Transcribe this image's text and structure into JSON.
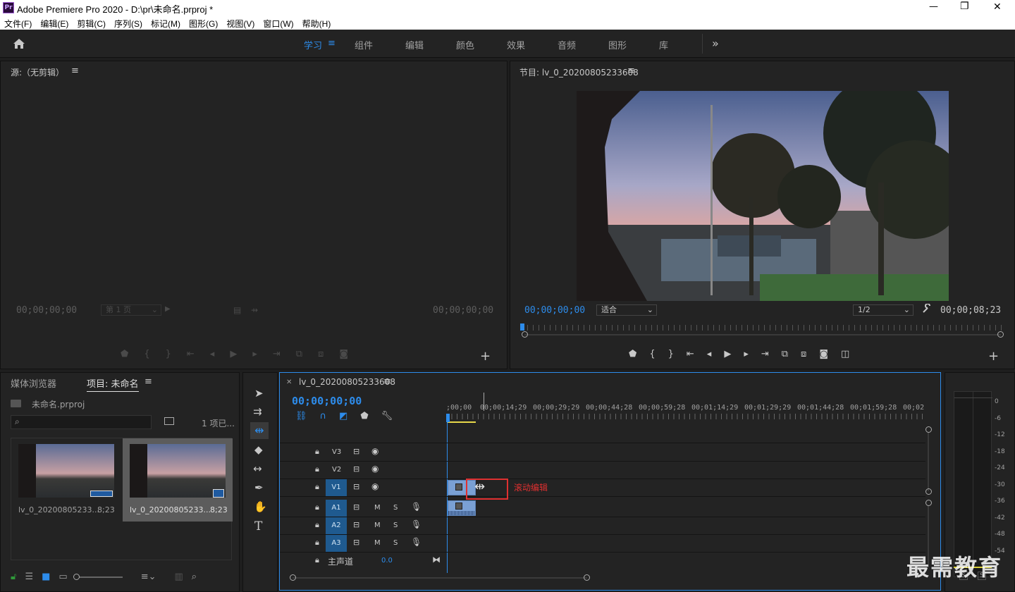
{
  "app": {
    "logo": "Pr",
    "title": "Adobe Premiere Pro 2020 - D:\\pr\\未命名.prproj *",
    "window_controls": {
      "minimize": "—",
      "maximize": "❐",
      "close": "✕"
    }
  },
  "menu": [
    "文件(F)",
    "编辑(E)",
    "剪辑(C)",
    "序列(S)",
    "标记(M)",
    "图形(G)",
    "视图(V)",
    "窗口(W)",
    "帮助(H)"
  ],
  "workspaces": {
    "tabs": [
      "学习",
      "组件",
      "编辑",
      "颜色",
      "效果",
      "音频",
      "图形",
      "库"
    ],
    "active": "学习",
    "more": "»"
  },
  "source_monitor": {
    "title": "源:（无剪辑）",
    "timecode_left": "00;00;00;00",
    "page_select": "第 1 页",
    "timecode_right": "00;00;00;00"
  },
  "program_monitor": {
    "title": "节目: lv_0_20200805233608",
    "timecode": "00;00;00;00",
    "fit_select": "适合",
    "resolution_select": "1/2",
    "duration": "00;00;08;23"
  },
  "project_panel": {
    "tabs": [
      "媒体浏览器",
      "项目: 未命名"
    ],
    "project_file": "未命名.prproj",
    "item_count": "1 项已...",
    "search_placeholder": "",
    "clips": [
      {
        "name": "lv_0_20200805233...",
        "duration": "8;23"
      },
      {
        "name": "lv_0_20200805233...",
        "duration": "8;23"
      }
    ]
  },
  "timeline": {
    "sequence_tab": "lv_0_20200805233608",
    "timecode": "00;00;00;00",
    "ruler": [
      ";00;00",
      "00;00;14;29",
      "00;00;29;29",
      "00;00;44;28",
      "00;00;59;28",
      "00;01;14;29",
      "00;01;29;29",
      "00;01;44;28",
      "00;01;59;28",
      "00;02;"
    ],
    "video_tracks": [
      "V3",
      "V2",
      "V1"
    ],
    "audio_tracks": [
      "A1",
      "A2",
      "A3"
    ],
    "master_label": "主声道",
    "master_value": "0.0",
    "annotation": "滚动编辑",
    "mute": "M",
    "solo": "S"
  },
  "audio_meter": {
    "scale": [
      "0",
      "-6",
      "-12",
      "-18",
      "-24",
      "-30",
      "-36",
      "-42",
      "-48",
      "-54"
    ],
    "solo_labels": [
      "S",
      "S"
    ]
  },
  "watermark": "最需教育",
  "colors": {
    "accent": "#2d8ceb",
    "annotation": "#e03030",
    "track_active": "#1f5a8f"
  }
}
